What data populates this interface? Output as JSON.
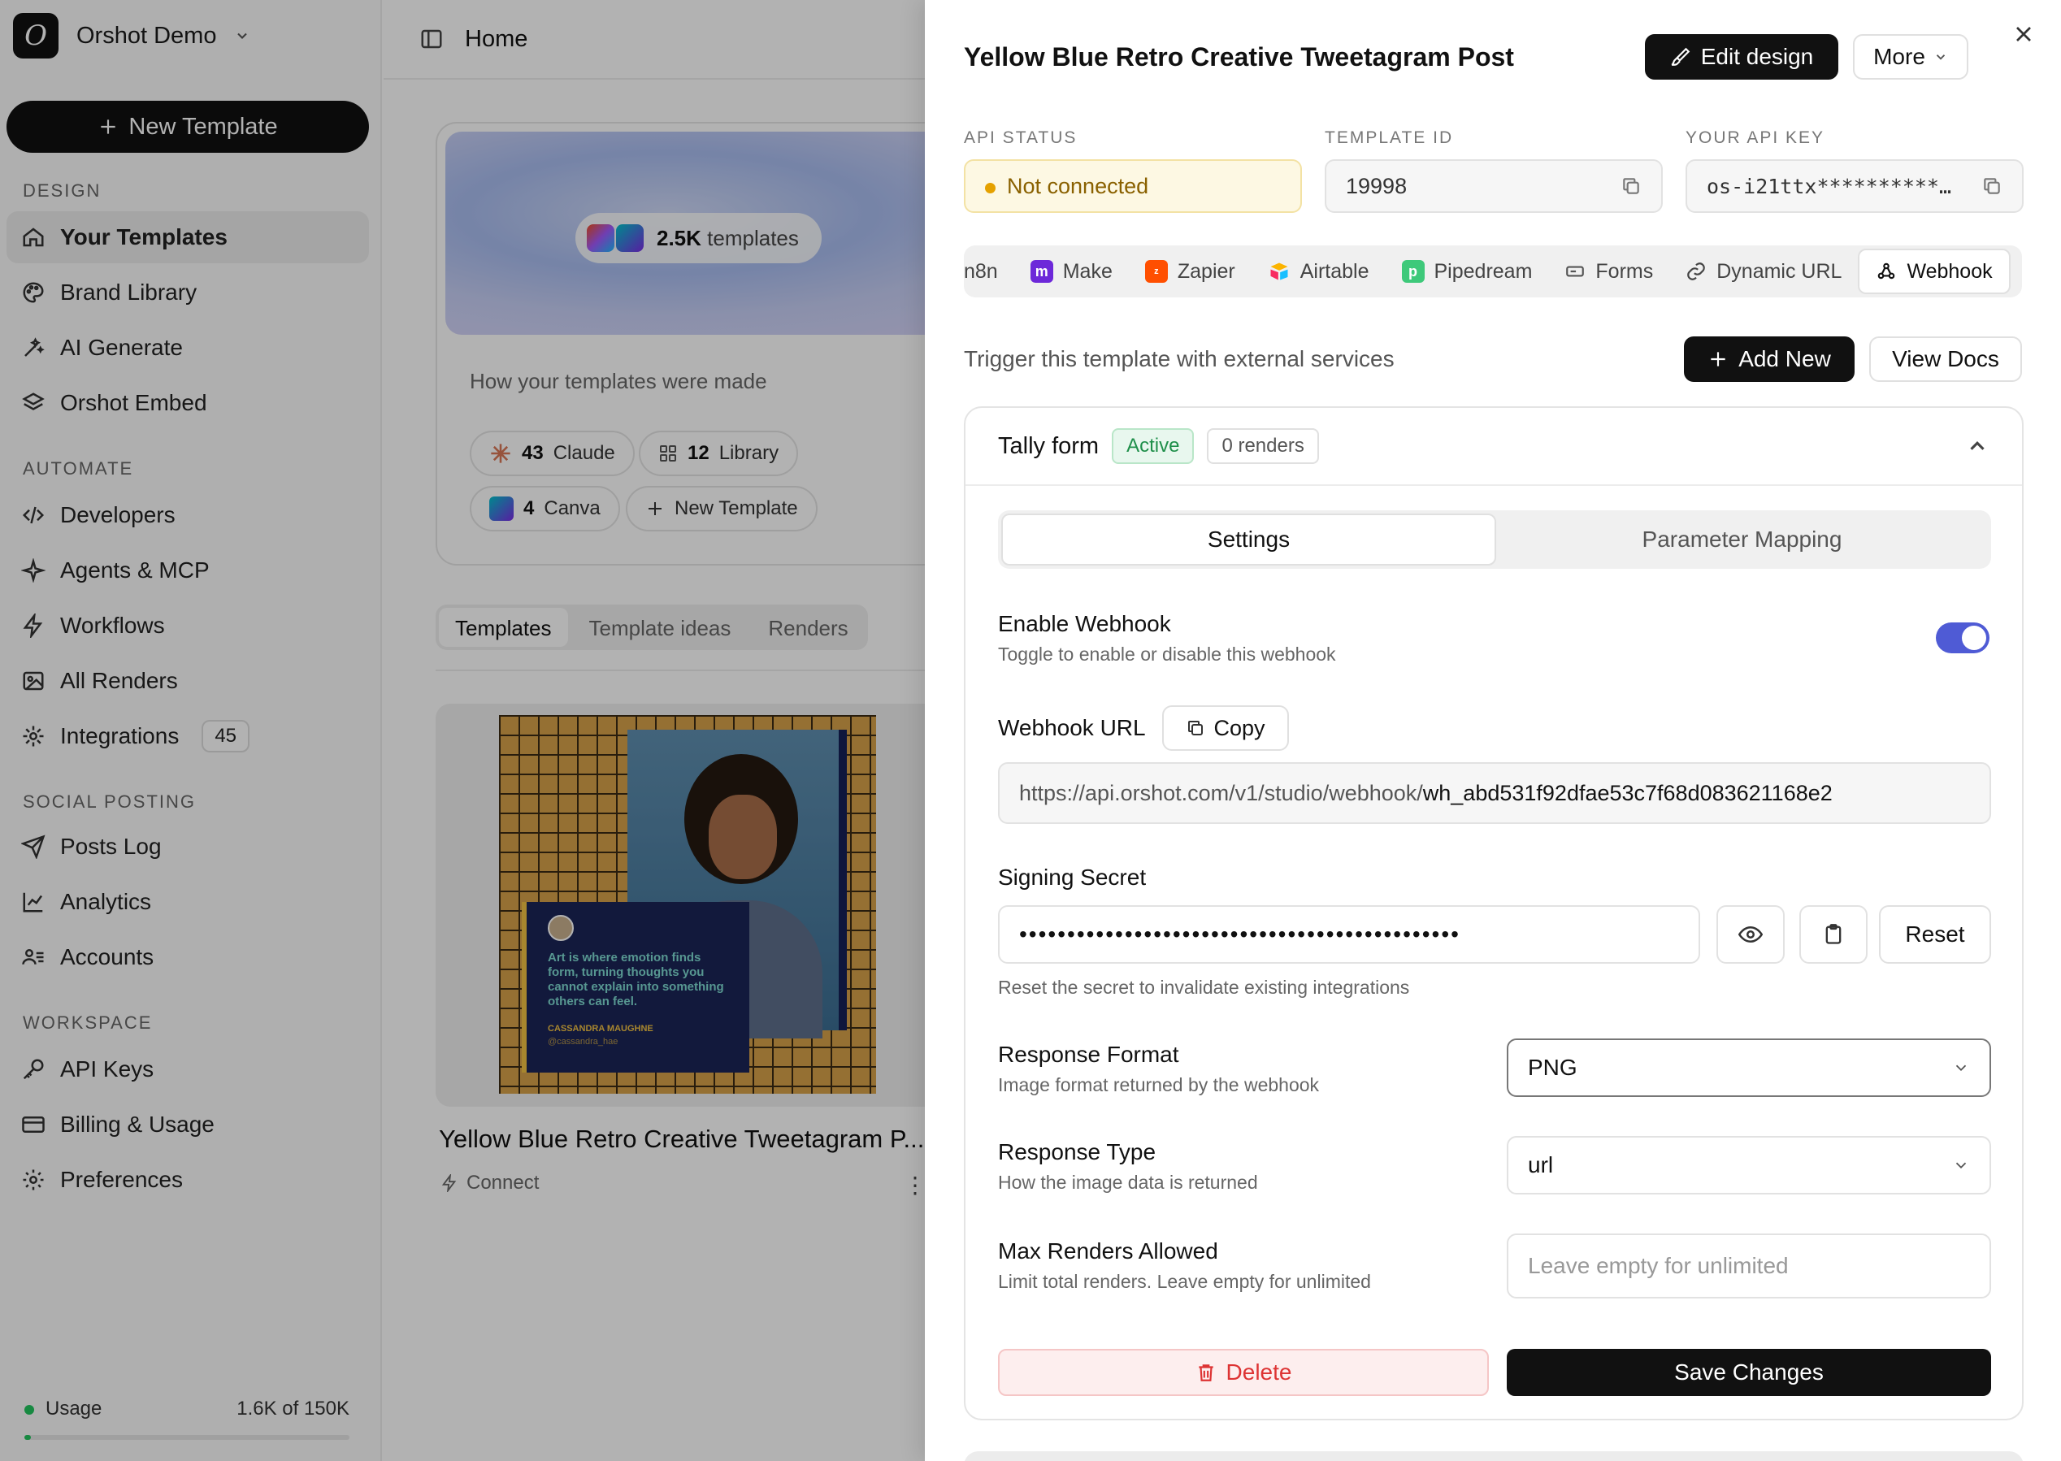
{
  "sidebar": {
    "workspace_name": "Orshot Demo",
    "new_template_label": "New Template",
    "sections": {
      "design": "DESIGN",
      "automate": "AUTOMATE",
      "social": "SOCIAL POSTING",
      "workspace": "WORKSPACE"
    },
    "items": {
      "your_templates": "Your Templates",
      "brand_library": "Brand Library",
      "ai_generate": "AI Generate",
      "orshot_embed": "Orshot Embed",
      "developers": "Developers",
      "agents_mcp": "Agents & MCP",
      "workflows": "Workflows",
      "all_renders": "All Renders",
      "integrations": "Integrations",
      "integrations_count": "45",
      "posts_log": "Posts Log",
      "analytics": "Analytics",
      "accounts": "Accounts",
      "api_keys": "API Keys",
      "billing": "Billing & Usage",
      "preferences": "Preferences"
    },
    "usage": {
      "label": "Usage",
      "value": "1.6K of 150K",
      "fraction": 0.011
    }
  },
  "main": {
    "page_title": "Home",
    "stats_card": {
      "templates_count": "2.5K",
      "templates_suffix": "templates",
      "subtitle": "How your templates were made",
      "chips": [
        {
          "count": "43",
          "label": "Claude"
        },
        {
          "count": "12",
          "label": "Library"
        },
        {
          "count": "4",
          "label": "Canva"
        }
      ],
      "new_template": "New Template"
    },
    "tabs": [
      "Templates",
      "Template ideas",
      "Renders"
    ],
    "template_card": {
      "title": "Yellow Blue Retro Creative Tweetagram P...",
      "connect": "Connect",
      "poster_quote": "Art is where emotion finds form, turning thoughts you cannot explain into something others can feel.",
      "poster_author": "CASSANDRA MAUGHNE",
      "poster_handle": "@cassandra_hae"
    }
  },
  "drawer": {
    "title": "Yellow Blue Retro Creative Tweetagram Post",
    "edit_design": "Edit design",
    "more": "More",
    "api_status_label": "API STATUS",
    "api_status_value": "Not connected",
    "template_id_label": "TEMPLATE ID",
    "template_id_value": "19998",
    "api_key_label": "YOUR API KEY",
    "api_key_value": "os-i21ttx**********…",
    "services": [
      "n8n",
      "Make",
      "Zapier",
      "Airtable",
      "Pipedream",
      "Forms",
      "Dynamic URL",
      "Webhook"
    ],
    "trigger_text": "Trigger this template with external services",
    "add_new": "Add New",
    "view_docs": "View Docs",
    "hook": {
      "name": "Tally form",
      "status": "Active",
      "renders": "0 renders",
      "seg_settings": "Settings",
      "seg_mapping": "Parameter Mapping",
      "enable_label": "Enable Webhook",
      "enable_sub": "Toggle to enable or disable this webhook",
      "url_label": "Webhook URL",
      "copy": "Copy",
      "url_prefix": "https://api.orshot.com/v1/studio/webhook/",
      "url_id": "wh_abd531f92dfae53c7f68d083621168e2",
      "secret_label": "Signing Secret",
      "secret_mask": "••••••••••••••••••••••••••••••••••••••••••••••",
      "reset": "Reset",
      "secret_help": "Reset the secret to invalidate existing integrations",
      "format_label": "Response Format",
      "format_sub": "Image format returned by the webhook",
      "format_value": "PNG",
      "type_label": "Response Type",
      "type_sub": "How the image data is returned",
      "type_value": "url",
      "max_label": "Max Renders Allowed",
      "max_sub": "Limit total renders. Leave empty for unlimited",
      "max_placeholder": "Leave empty for unlimited",
      "delete": "Delete",
      "save": "Save Changes"
    }
  }
}
